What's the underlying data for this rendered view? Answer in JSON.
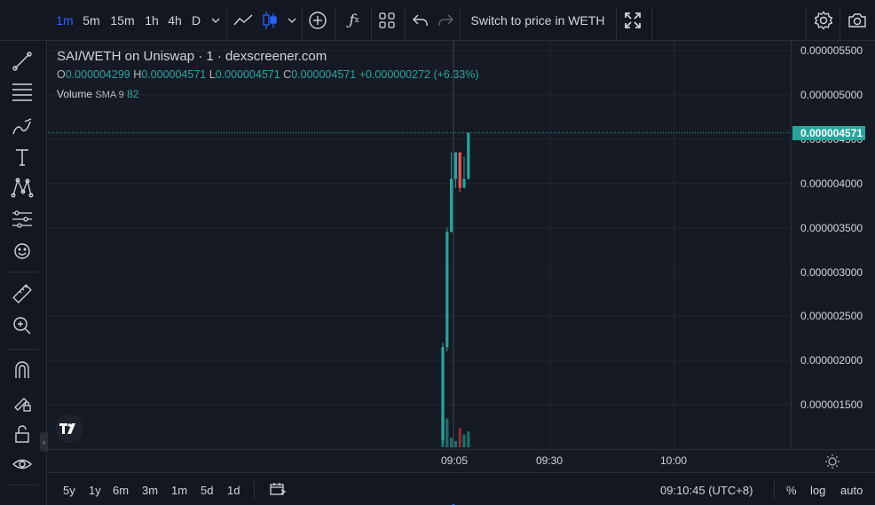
{
  "toolbar": {
    "intervals": [
      "1m",
      "5m",
      "15m",
      "1h",
      "4h",
      "D"
    ],
    "active_interval": "1m",
    "switch_label": "Switch to price in WETH"
  },
  "legend": {
    "title": "SAI/WETH on Uniswap · 1 · dexscreener.com",
    "o_label": "O",
    "o_value": "0.000004299",
    "h_label": "H",
    "h_value": "0.000004571",
    "l_label": "L",
    "l_value": "0.000004571",
    "c_label": "C",
    "c_value": "0.000004571",
    "change": "+0.000000272 (+6.33%)",
    "volume_label": "Volume",
    "volume_sma": "SMA 9",
    "volume_value": "82"
  },
  "price_axis": {
    "labels": [
      "0.000005500",
      "0.000005000",
      "0.000004500",
      "0.000004000",
      "0.000003500",
      "0.000003000",
      "0.000002500",
      "0.000002000",
      "0.000001500"
    ],
    "current_price": "0.000004571"
  },
  "time_axis": {
    "labels": [
      "09:05",
      "09:30",
      "10:00"
    ]
  },
  "bottom_bar": {
    "ranges": [
      "5y",
      "1y",
      "6m",
      "3m",
      "1m",
      "5d",
      "1d"
    ],
    "clock": "09:10:45 (UTC+8)",
    "percent_label": "%",
    "log_label": "log",
    "auto_label": "auto"
  },
  "colors": {
    "up": "#26a69a",
    "down": "#ef5350",
    "accent": "#2962ff",
    "background": "#131722"
  },
  "chart_data": {
    "type": "candlestick",
    "candles": [
      {
        "open": 1.1e-06,
        "high": 2.2e-06,
        "low": 1.05e-06,
        "close": 2.15e-06,
        "volume_level": 1.0
      },
      {
        "open": 2.15e-06,
        "high": 3.5e-06,
        "low": 2.1e-06,
        "close": 3.45e-06,
        "volume_level": 0.45
      },
      {
        "open": 3.45e-06,
        "high": 4.35e-06,
        "low": 3.45e-06,
        "close": 4.05e-06,
        "volume_level": 0.15
      },
      {
        "open": 4.05e-06,
        "high": 4.35e-06,
        "low": 3.95e-06,
        "close": 4.35e-06,
        "volume_level": 0.1
      },
      {
        "open": 4.35e-06,
        "high": 4.35e-06,
        "low": 3.9e-06,
        "close": 3.95e-06,
        "volume_level": 0.3
      },
      {
        "open": 3.95e-06,
        "high": 4.3e-06,
        "low": 3.95e-06,
        "close": 4.05e-06,
        "volume_level": 0.2
      },
      {
        "open": 4.05e-06,
        "high": 4.571e-06,
        "low": 4.05e-06,
        "close": 4.571e-06,
        "volume_level": 0.25
      }
    ]
  }
}
